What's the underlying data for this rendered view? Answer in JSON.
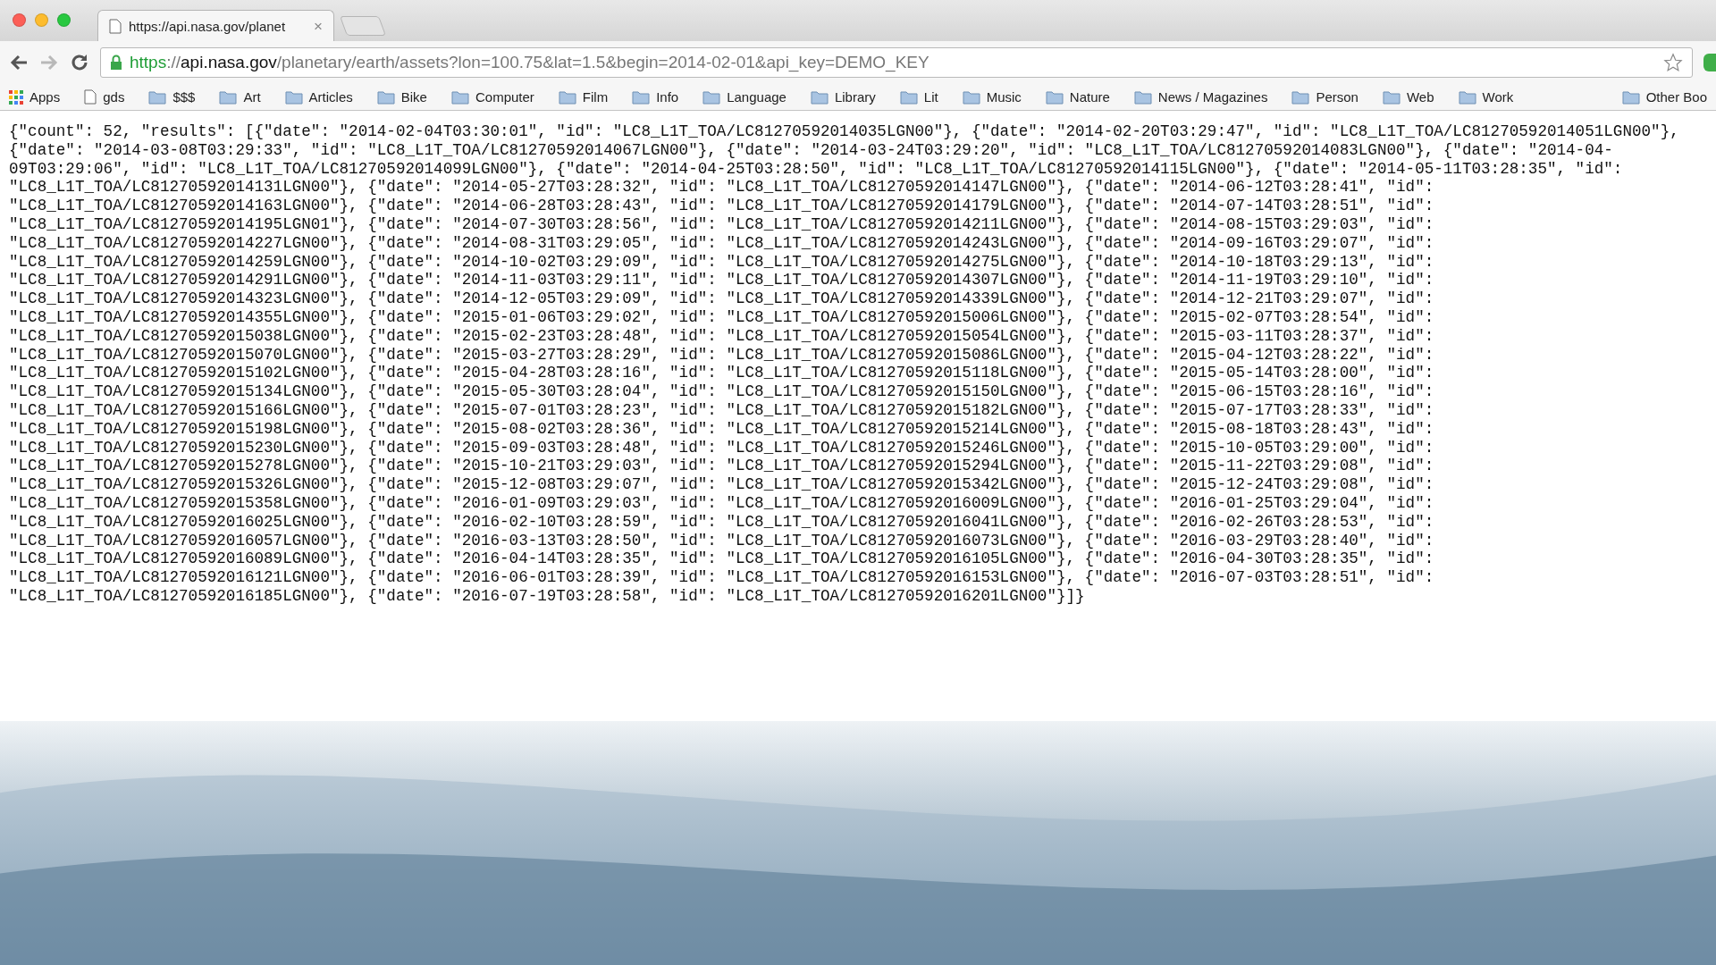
{
  "tabs": [
    {
      "title": "https://api.nasa.gov/planet",
      "selected": true,
      "close": "×"
    }
  ],
  "address": {
    "scheme": "https",
    "separator": "://",
    "host": "api.nasa.gov",
    "path": "/planetary/earth/assets?lon=100.75&lat=1.5&begin=2014-02-01&api_key=DEMO_KEY"
  },
  "bookmarks": [
    {
      "label": "Apps",
      "kind": "apps"
    },
    {
      "label": "gds",
      "kind": "page"
    },
    {
      "label": "$$$",
      "kind": "folder"
    },
    {
      "label": "Art",
      "kind": "folder"
    },
    {
      "label": "Articles",
      "kind": "folder"
    },
    {
      "label": "Bike",
      "kind": "folder"
    },
    {
      "label": "Computer",
      "kind": "folder"
    },
    {
      "label": "Film",
      "kind": "folder"
    },
    {
      "label": "Info",
      "kind": "folder"
    },
    {
      "label": "Language",
      "kind": "folder"
    },
    {
      "label": "Library",
      "kind": "folder"
    },
    {
      "label": "Lit",
      "kind": "folder"
    },
    {
      "label": "Music",
      "kind": "folder"
    },
    {
      "label": "Nature",
      "kind": "folder"
    },
    {
      "label": "News / Magazines",
      "kind": "folder"
    },
    {
      "label": "Person",
      "kind": "folder"
    },
    {
      "label": "Web",
      "kind": "folder"
    },
    {
      "label": "Work",
      "kind": "folder"
    }
  ],
  "other_bookmarks": {
    "label": "Other Boo",
    "kind": "folder"
  },
  "response_lines": [
    "{\"count\": 52, \"results\": [{\"date\": \"2014-02-04T03:30:01\", \"id\": \"LC8_L1T_TOA/LC81270592014035LGN00\"}, {\"date\": \"2014-02-20T03:29:47\", \"id\": \"LC8_L1T_TOA/LC81270592014051LGN00\"},",
    "{\"date\": \"2014-03-08T03:29:33\", \"id\": \"LC8_L1T_TOA/LC81270592014067LGN00\"}, {\"date\": \"2014-03-24T03:29:20\", \"id\": \"LC8_L1T_TOA/LC81270592014083LGN00\"}, {\"date\": \"2014-04-",
    "09T03:29:06\", \"id\": \"LC8_L1T_TOA/LC81270592014099LGN00\"}, {\"date\": \"2014-04-25T03:28:50\", \"id\": \"LC8_L1T_TOA/LC81270592014115LGN00\"}, {\"date\": \"2014-05-11T03:28:35\", \"id\":",
    "\"LC8_L1T_TOA/LC81270592014131LGN00\"}, {\"date\": \"2014-05-27T03:28:32\", \"id\": \"LC8_L1T_TOA/LC81270592014147LGN00\"}, {\"date\": \"2014-06-12T03:28:41\", \"id\":",
    "\"LC8_L1T_TOA/LC81270592014163LGN00\"}, {\"date\": \"2014-06-28T03:28:43\", \"id\": \"LC8_L1T_TOA/LC81270592014179LGN00\"}, {\"date\": \"2014-07-14T03:28:51\", \"id\":",
    "\"LC8_L1T_TOA/LC81270592014195LGN01\"}, {\"date\": \"2014-07-30T03:28:56\", \"id\": \"LC8_L1T_TOA/LC81270592014211LGN00\"}, {\"date\": \"2014-08-15T03:29:03\", \"id\":",
    "\"LC8_L1T_TOA/LC81270592014227LGN00\"}, {\"date\": \"2014-08-31T03:29:05\", \"id\": \"LC8_L1T_TOA/LC81270592014243LGN00\"}, {\"date\": \"2014-09-16T03:29:07\", \"id\":",
    "\"LC8_L1T_TOA/LC81270592014259LGN00\"}, {\"date\": \"2014-10-02T03:29:09\", \"id\": \"LC8_L1T_TOA/LC81270592014275LGN00\"}, {\"date\": \"2014-10-18T03:29:13\", \"id\":",
    "\"LC8_L1T_TOA/LC81270592014291LGN00\"}, {\"date\": \"2014-11-03T03:29:11\", \"id\": \"LC8_L1T_TOA/LC81270592014307LGN00\"}, {\"date\": \"2014-11-19T03:29:10\", \"id\":",
    "\"LC8_L1T_TOA/LC81270592014323LGN00\"}, {\"date\": \"2014-12-05T03:29:09\", \"id\": \"LC8_L1T_TOA/LC81270592014339LGN00\"}, {\"date\": \"2014-12-21T03:29:07\", \"id\":",
    "\"LC8_L1T_TOA/LC81270592014355LGN00\"}, {\"date\": \"2015-01-06T03:29:02\", \"id\": \"LC8_L1T_TOA/LC81270592015006LGN00\"}, {\"date\": \"2015-02-07T03:28:54\", \"id\":",
    "\"LC8_L1T_TOA/LC81270592015038LGN00\"}, {\"date\": \"2015-02-23T03:28:48\", \"id\": \"LC8_L1T_TOA/LC81270592015054LGN00\"}, {\"date\": \"2015-03-11T03:28:37\", \"id\":",
    "\"LC8_L1T_TOA/LC81270592015070LGN00\"}, {\"date\": \"2015-03-27T03:28:29\", \"id\": \"LC8_L1T_TOA/LC81270592015086LGN00\"}, {\"date\": \"2015-04-12T03:28:22\", \"id\":",
    "\"LC8_L1T_TOA/LC81270592015102LGN00\"}, {\"date\": \"2015-04-28T03:28:16\", \"id\": \"LC8_L1T_TOA/LC81270592015118LGN00\"}, {\"date\": \"2015-05-14T03:28:00\", \"id\":",
    "\"LC8_L1T_TOA/LC81270592015134LGN00\"}, {\"date\": \"2015-05-30T03:28:04\", \"id\": \"LC8_L1T_TOA/LC81270592015150LGN00\"}, {\"date\": \"2015-06-15T03:28:16\", \"id\":",
    "\"LC8_L1T_TOA/LC81270592015166LGN00\"}, {\"date\": \"2015-07-01T03:28:23\", \"id\": \"LC8_L1T_TOA/LC81270592015182LGN00\"}, {\"date\": \"2015-07-17T03:28:33\", \"id\":",
    "\"LC8_L1T_TOA/LC81270592015198LGN00\"}, {\"date\": \"2015-08-02T03:28:36\", \"id\": \"LC8_L1T_TOA/LC81270592015214LGN00\"}, {\"date\": \"2015-08-18T03:28:43\", \"id\":",
    "\"LC8_L1T_TOA/LC81270592015230LGN00\"}, {\"date\": \"2015-09-03T03:28:48\", \"id\": \"LC8_L1T_TOA/LC81270592015246LGN00\"}, {\"date\": \"2015-10-05T03:29:00\", \"id\":",
    "\"LC8_L1T_TOA/LC81270592015278LGN00\"}, {\"date\": \"2015-10-21T03:29:03\", \"id\": \"LC8_L1T_TOA/LC81270592015294LGN00\"}, {\"date\": \"2015-11-22T03:29:08\", \"id\":",
    "\"LC8_L1T_TOA/LC81270592015326LGN00\"}, {\"date\": \"2015-12-08T03:29:07\", \"id\": \"LC8_L1T_TOA/LC81270592015342LGN00\"}, {\"date\": \"2015-12-24T03:29:08\", \"id\":",
    "\"LC8_L1T_TOA/LC81270592015358LGN00\"}, {\"date\": \"2016-01-09T03:29:03\", \"id\": \"LC8_L1T_TOA/LC81270592016009LGN00\"}, {\"date\": \"2016-01-25T03:29:04\", \"id\":",
    "\"LC8_L1T_TOA/LC81270592016025LGN00\"}, {\"date\": \"2016-02-10T03:28:59\", \"id\": \"LC8_L1T_TOA/LC81270592016041LGN00\"}, {\"date\": \"2016-02-26T03:28:53\", \"id\":",
    "\"LC8_L1T_TOA/LC81270592016057LGN00\"}, {\"date\": \"2016-03-13T03:28:50\", \"id\": \"LC8_L1T_TOA/LC81270592016073LGN00\"}, {\"date\": \"2016-03-29T03:28:40\", \"id\":",
    "\"LC8_L1T_TOA/LC81270592016089LGN00\"}, {\"date\": \"2016-04-14T03:28:35\", \"id\": \"LC8_L1T_TOA/LC81270592016105LGN00\"}, {\"date\": \"2016-04-30T03:28:35\", \"id\":",
    "\"LC8_L1T_TOA/LC81270592016121LGN00\"}, {\"date\": \"2016-06-01T03:28:39\", \"id\": \"LC8_L1T_TOA/LC81270592016153LGN00\"}, {\"date\": \"2016-07-03T03:28:51\", \"id\":",
    "\"LC8_L1T_TOA/LC81270592016185LGN00\"}, {\"date\": \"2016-07-19T03:28:58\", \"id\": \"LC8_L1T_TOA/LC81270592016201LGN00\"}]}"
  ]
}
